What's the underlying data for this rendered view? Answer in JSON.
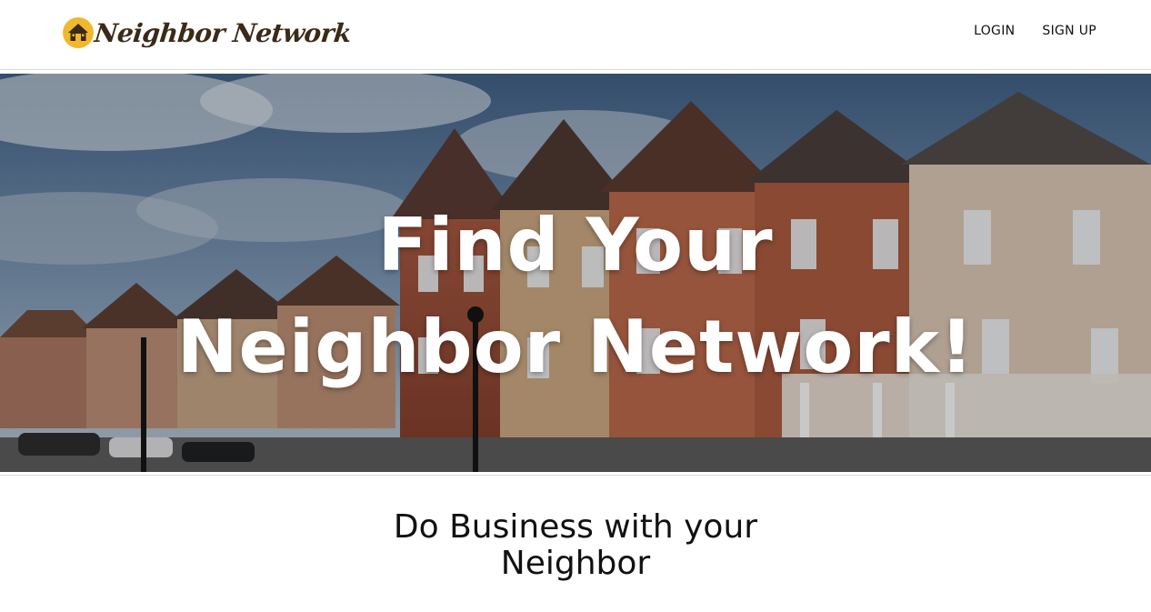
{
  "header": {
    "brand_name": "Neighbor Network",
    "logo_icon": "house-icon",
    "nav": {
      "login_label": "LOGIN",
      "signup_label": "SIGN UP"
    }
  },
  "hero": {
    "title_line1": "Find Your",
    "title_line2": "Neighbor Network!"
  },
  "section": {
    "heading": "Do Business with your Neighbor"
  },
  "colors": {
    "brand_text": "#3a2a18",
    "logo_circle": "#f1b82d",
    "text": "#111111"
  }
}
